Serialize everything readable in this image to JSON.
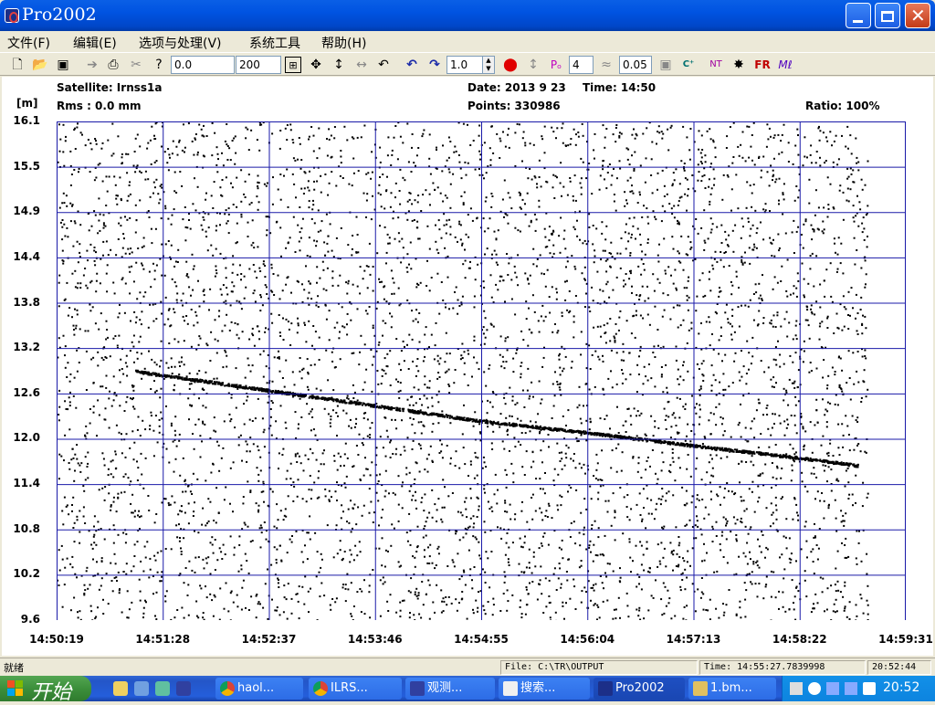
{
  "window": {
    "title": "Pro2002"
  },
  "menu": [
    "文件(F)",
    "编辑(E)",
    "选项与处理(V)",
    "系统工具",
    "帮助(H)"
  ],
  "toolbar": {
    "input1": "0.0",
    "input2": "200",
    "input3": "1.0",
    "input4": "4",
    "input5": "0.05",
    "label_p": "Pₒ",
    "label_fr": "FR",
    "label_nt": "NT"
  },
  "header": {
    "satellite": "Satellite: Irnss1a",
    "rms": "Rms :   0.0 mm",
    "date": "Date: 2013  9 23",
    "time": "Time: 14:50",
    "points": "Points: 330986",
    "ratio": "Ratio: 100%",
    "unit": "[m]"
  },
  "chart_data": {
    "type": "scatter",
    "title": "",
    "ylabel": "[m]",
    "xlabel": "",
    "ylim": [
      9.6,
      16.1
    ],
    "y_ticks": [
      "16.1",
      "15.5",
      "14.9",
      "14.4",
      "13.8",
      "13.2",
      "12.6",
      "12.0",
      "11.4",
      "10.8",
      "10.2",
      "9.6"
    ],
    "x_ticks": [
      "14:50:19",
      "14:51:28",
      "14:52:37",
      "14:53:46",
      "14:54:55",
      "14:56:04",
      "14:57:13",
      "14:58:22",
      "14:59:31"
    ],
    "grid": true,
    "noise_density": "uniform background noise points across full range",
    "track": {
      "description": "dense line of return points",
      "points": [
        {
          "t": "14:51:10",
          "y": 12.85
        },
        {
          "t": "14:52:37",
          "y": 12.6
        },
        {
          "t": "14:53:46",
          "y": 12.4
        },
        {
          "t": "14:54:55",
          "y": 12.2
        },
        {
          "t": "14:56:04",
          "y": 12.05
        },
        {
          "t": "14:57:13",
          "y": 11.88
        },
        {
          "t": "14:58:22",
          "y": 11.72
        },
        {
          "t": "14:59:00",
          "y": 11.62
        }
      ]
    }
  },
  "status": {
    "ready": "就绪",
    "file": "File: C:\\TR\\OUTPUT",
    "time": "Time: 14:55:27.7839998",
    "clock": "20:52:44"
  },
  "taskbar": {
    "start": "开始",
    "buttons": [
      "haol...",
      "ILRS...",
      "观测...",
      "搜索...",
      "Pro2002",
      "1.bm..."
    ],
    "clock": "20:52"
  }
}
